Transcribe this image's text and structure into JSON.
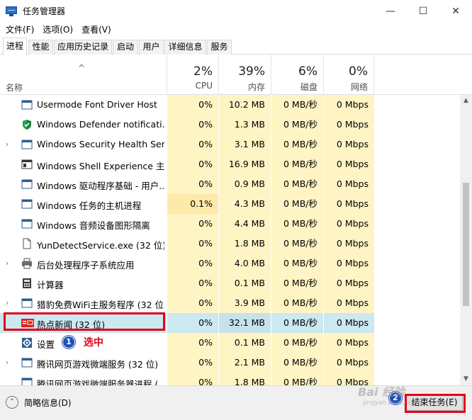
{
  "window": {
    "title": "任务管理器",
    "min": "—",
    "max": "☐",
    "close": "✕"
  },
  "menu": [
    "文件(F)",
    "选项(O)",
    "查看(V)"
  ],
  "tabs": [
    "进程",
    "性能",
    "应用历史记录",
    "启动",
    "用户",
    "详细信息",
    "服务"
  ],
  "header": {
    "name_label": "名称",
    "sort_arrow": "^",
    "cpu": {
      "pct": "2%",
      "label": "CPU"
    },
    "mem": {
      "pct": "39%",
      "label": "内存"
    },
    "disk": {
      "pct": "6%",
      "label": "磁盘"
    },
    "net": {
      "pct": "0%",
      "label": "网络"
    }
  },
  "rows": [
    {
      "name": "Usermode Font Driver Host",
      "cpu": "0%",
      "mem": "10.2 MB",
      "disk": "0 MB/秒",
      "net": "0 Mbps",
      "icon": "app-window-icon",
      "expand": false
    },
    {
      "name": "Windows Defender notificati...",
      "cpu": "0%",
      "mem": "1.3 MB",
      "disk": "0 MB/秒",
      "net": "0 Mbps",
      "icon": "defender-shield-icon",
      "expand": false
    },
    {
      "name": "Windows Security Health Ser...",
      "cpu": "0%",
      "mem": "3.1 MB",
      "disk": "0 MB/秒",
      "net": "0 Mbps",
      "icon": "app-window-icon",
      "expand": true
    },
    {
      "name": "Windows Shell Experience 主...",
      "cpu": "0%",
      "mem": "16.9 MB",
      "disk": "0 MB/秒",
      "net": "0 Mbps",
      "icon": "shell-window-icon",
      "expand": false
    },
    {
      "name": "Windows 驱动程序基础 - 用户...",
      "cpu": "0%",
      "mem": "0.9 MB",
      "disk": "0 MB/秒",
      "net": "0 Mbps",
      "icon": "app-window-icon",
      "expand": false
    },
    {
      "name": "Windows 任务的主机进程",
      "cpu": "0.1%",
      "mem": "4.3 MB",
      "disk": "0 MB/秒",
      "net": "0 Mbps",
      "icon": "app-window-icon",
      "expand": false
    },
    {
      "name": "Windows 音频设备图形隔离",
      "cpu": "0%",
      "mem": "4.4 MB",
      "disk": "0 MB/秒",
      "net": "0 Mbps",
      "icon": "app-window-icon",
      "expand": false
    },
    {
      "name": "YunDetectService.exe (32 位)",
      "cpu": "0%",
      "mem": "1.8 MB",
      "disk": "0 MB/秒",
      "net": "0 Mbps",
      "icon": "file-icon",
      "expand": false
    },
    {
      "name": "后台处理程序子系统应用",
      "cpu": "0%",
      "mem": "4.0 MB",
      "disk": "0 MB/秒",
      "net": "0 Mbps",
      "icon": "printer-icon",
      "expand": true
    },
    {
      "name": "计算器",
      "cpu": "0%",
      "mem": "0.1 MB",
      "disk": "0 MB/秒",
      "net": "0 Mbps",
      "icon": "calculator-icon",
      "expand": false
    },
    {
      "name": "猎豹免费WiFi主服务程序 (32 位)",
      "cpu": "0%",
      "mem": "3.9 MB",
      "disk": "0 MB/秒",
      "net": "0 Mbps",
      "icon": "app-window-icon",
      "expand": true
    },
    {
      "name": "热点新闻 (32 位)",
      "cpu": "0%",
      "mem": "32.1 MB",
      "disk": "0 MB/秒",
      "net": "0 Mbps",
      "icon": "news-icon",
      "expand": false,
      "selected": true
    },
    {
      "name": "设置",
      "cpu": "0%",
      "mem": "0.1 MB",
      "disk": "0 MB/秒",
      "net": "0 Mbps",
      "icon": "settings-gear-icon",
      "expand": false
    },
    {
      "name": "腾讯网页游戏微端服务 (32 位)",
      "cpu": "0%",
      "mem": "2.1 MB",
      "disk": "0 MB/秒",
      "net": "0 Mbps",
      "icon": "app-window-icon",
      "expand": true
    },
    {
      "name": "腾讯网页游戏微端服务器进程 (...",
      "cpu": "0%",
      "mem": "1.8 MB",
      "disk": "0 MB/秒",
      "net": "0 Mbps",
      "icon": "app-window-icon",
      "expand": false
    }
  ],
  "footer": {
    "less_details": "简略信息(D)",
    "end_task": "结束任务(E)"
  },
  "annotations": {
    "badge1": "1",
    "badge1_text": "选中",
    "badge2": "2"
  },
  "watermark": {
    "line1": "Bai 经验",
    "line2": "jingyan.baidu.com"
  },
  "colors": {
    "usage_cell": "#fff4c4",
    "selected_row": "#cce8f0",
    "annotation_red": "#e2001a",
    "badge_blue": "#1f50b8"
  }
}
